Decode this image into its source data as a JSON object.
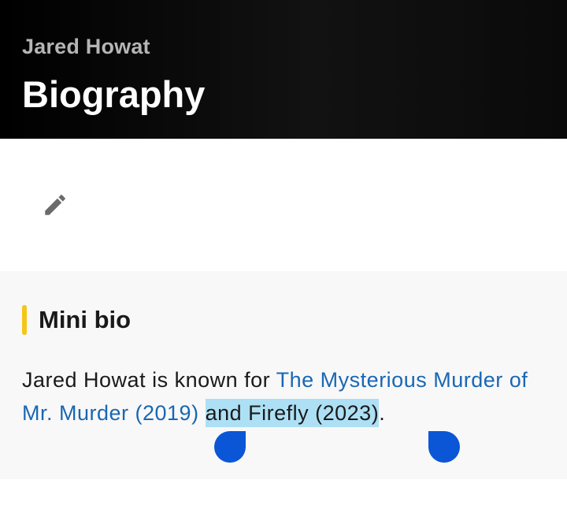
{
  "header": {
    "subtitle": "Jared Howat",
    "title": "Biography"
  },
  "toolbar": {
    "edit_icon": "pencil-icon"
  },
  "mini_bio": {
    "heading": "Mini bio",
    "accent_color": "#f5c518",
    "text_prefix": "Jared Howat is known for ",
    "link_1": "The Mysterious Murder of Mr. Murder (2019)",
    "text_middle": " and Firefly (2023)",
    "text_suffix": ".",
    "selected_text": "and Firefly (2023)"
  },
  "colors": {
    "link": "#1967b4",
    "selection_highlight": "#ade0f4",
    "selection_handle": "#0a56d6"
  }
}
